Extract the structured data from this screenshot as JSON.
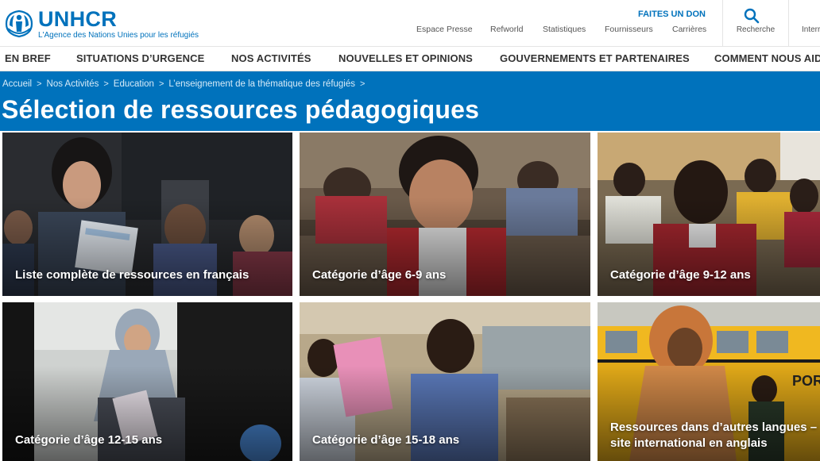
{
  "brand": {
    "name": "UNHCR",
    "tagline": "L'Agence des Nations Unies pour les réfugiés",
    "color": "#0072bc"
  },
  "header": {
    "donate_label": "FAITES UN DON",
    "utility_links": [
      "Espace Presse",
      "Refworld",
      "Statistiques",
      "Fournisseurs",
      "Carrières"
    ],
    "search_label": "Recherche",
    "search_icon": "search-icon",
    "extra_link": "Interr"
  },
  "nav": {
    "items": [
      "EN BREF",
      "SITUATIONS D’URGENCE",
      "NOS ACTIVITÉS",
      "NOUVELLES ET OPINIONS",
      "GOUVERNEMENTS ET PARTENAIRES",
      "COMMENT NOUS AIDER"
    ]
  },
  "breadcrumb": {
    "items": [
      "Accueil",
      "Nos Activités",
      "Education",
      "L’enseignement de la thématique des réfugiés"
    ],
    "separator": ">"
  },
  "page": {
    "title": "Sélection de ressources pédagogiques",
    "hero_color": "#0072bc"
  },
  "tiles": [
    {
      "label": "Liste complète de ressources en français"
    },
    {
      "label": "Catégorie d’âge 6-9 ans"
    },
    {
      "label": "Catégorie d’âge 9-12 ans"
    },
    {
      "label": "Catégorie d’âge 12-15 ans"
    },
    {
      "label": "Catégorie d’âge 15-18 ans"
    },
    {
      "label_line1": "Ressources dans d’autres langues –",
      "label_line2": "site international en anglais"
    }
  ]
}
